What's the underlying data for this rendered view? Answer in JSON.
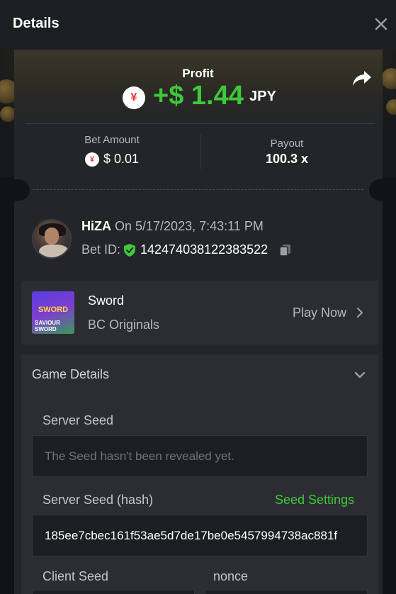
{
  "header": {
    "title": "Details"
  },
  "profit": {
    "label": "Profit",
    "currency_icon": "¥",
    "value": "+$ 1.44",
    "currency": "JPY"
  },
  "bet": {
    "label": "Bet Amount",
    "currency_icon": "¥",
    "value": "$ 0.01"
  },
  "payout": {
    "label": "Payout",
    "value": "100.3 x"
  },
  "user": {
    "name": "HiZA",
    "date": "On 5/17/2023, 7:43:11 PM",
    "bet_id_label": "Bet ID:",
    "bet_id": "142474038122383522"
  },
  "game": {
    "name": "Sword",
    "provider": "BC Originals",
    "play_label": "Play Now",
    "thumb_title": "SWORD",
    "thumb_subtitle": "SAVIOUR SWORD"
  },
  "details": {
    "title": "Game Details",
    "server_seed_label": "Server Seed",
    "server_seed_placeholder": "The Seed hasn't been revealed yet.",
    "server_seed_hash_label": "Server Seed (hash)",
    "seed_settings_label": "Seed Settings",
    "server_seed_hash": "185ee7cbec161f53ae5d7de17be0e5457994738ac881f",
    "client_seed_label": "Client Seed",
    "nonce_label": "nonce"
  },
  "colors": {
    "accent_green": "#3ec93a",
    "panel": "#232529",
    "card": "#2b2d32",
    "background": "#121316"
  }
}
